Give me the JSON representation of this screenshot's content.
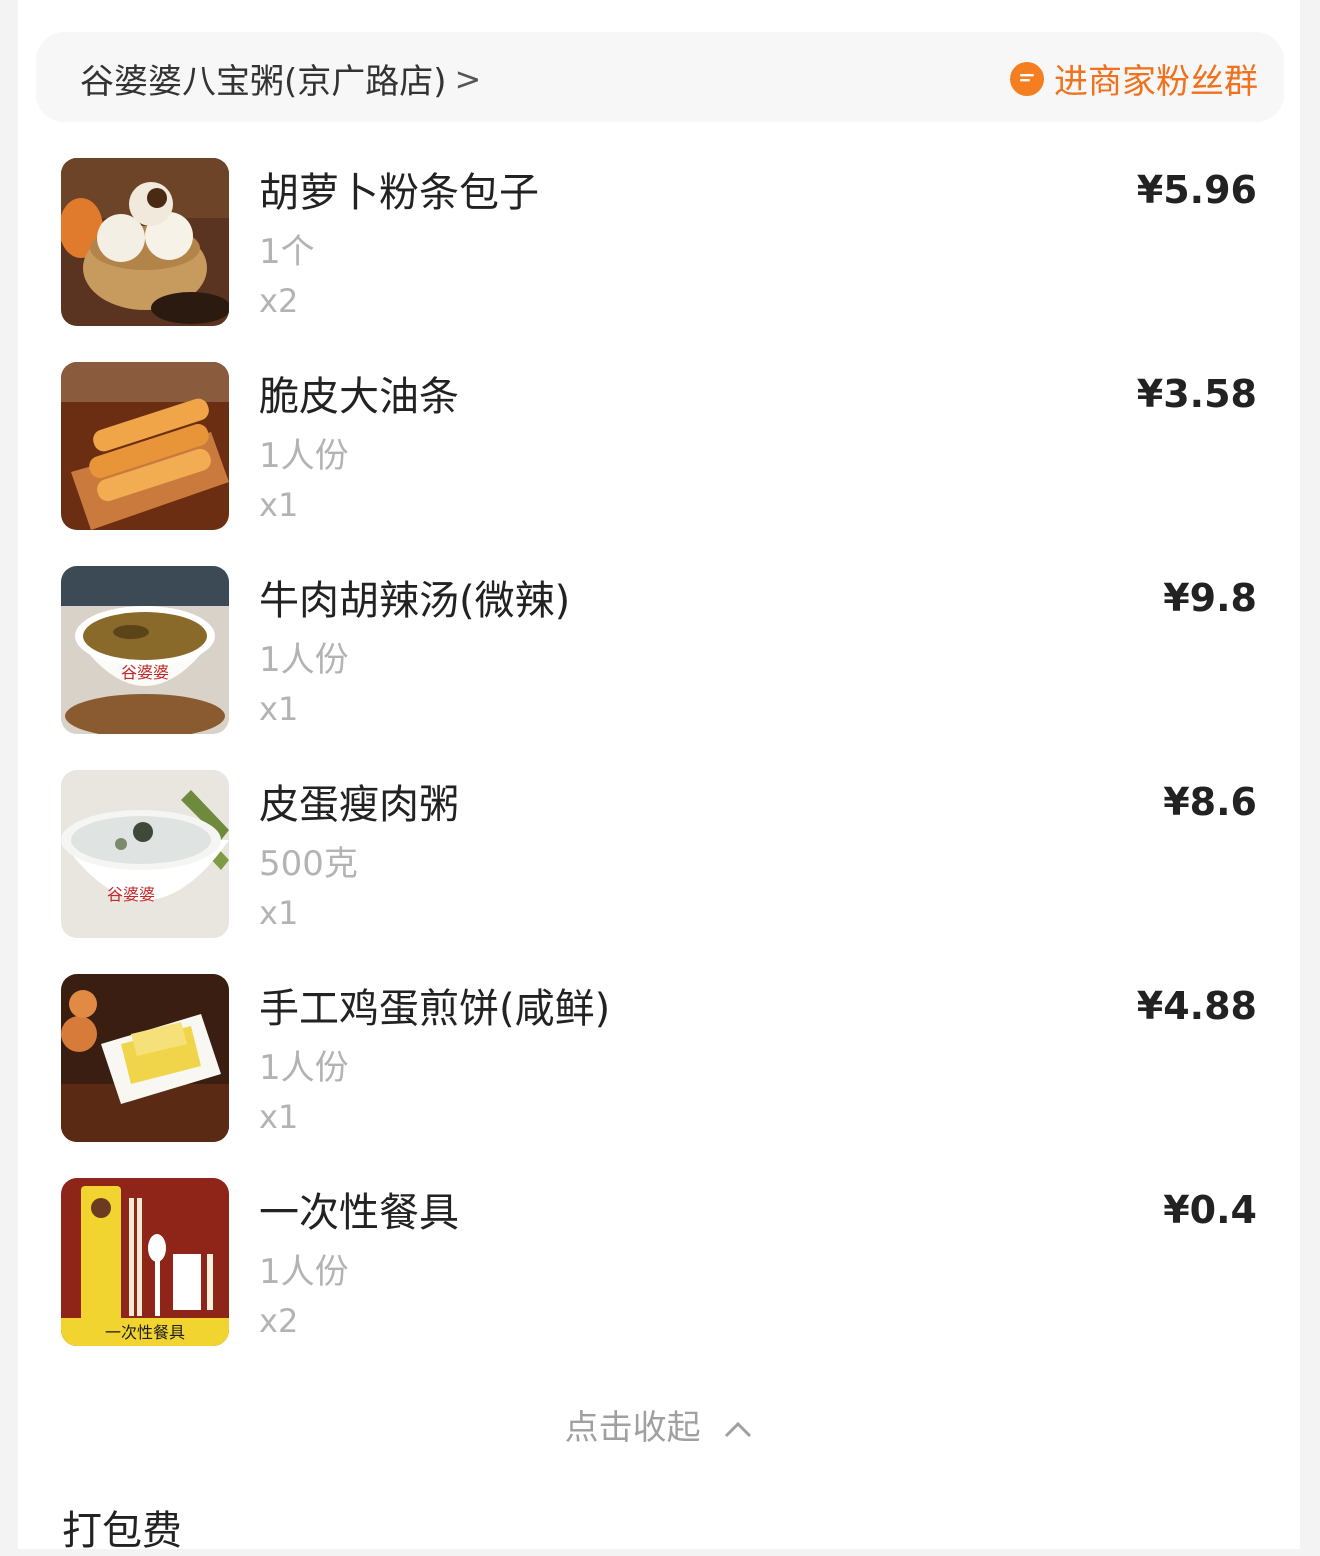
{
  "store": {
    "name": "谷婆婆八宝粥(京广路店)",
    "chevron": ">",
    "fans_label": "进商家粉丝群",
    "fans_icon": "chat-bubble-icon",
    "accent_color": "#f0711e"
  },
  "items": [
    {
      "name": "胡萝卜粉条包子",
      "spec": "1个",
      "qty": "x2",
      "price": "¥5.96",
      "image": "steamed-buns-photo"
    },
    {
      "name": "脆皮大油条",
      "spec": "1人份",
      "qty": "x1",
      "price": "¥3.58",
      "image": "fried-dough-sticks-photo"
    },
    {
      "name": "牛肉胡辣汤(微辣)",
      "spec": "1人份",
      "qty": "x1",
      "price": "¥9.8",
      "image": "spicy-soup-photo"
    },
    {
      "name": "皮蛋瘦肉粥",
      "spec": "500克",
      "qty": "x1",
      "price": "¥8.6",
      "image": "congee-photo"
    },
    {
      "name": "手工鸡蛋煎饼(咸鲜)",
      "spec": "1人份",
      "qty": "x1",
      "price": "¥4.88",
      "image": "egg-pancake-photo"
    },
    {
      "name": "一次性餐具",
      "spec": "1人份",
      "qty": "x2",
      "price": "¥0.4",
      "image": "cutlery-pack-photo"
    }
  ],
  "collapse": {
    "label": "点击收起",
    "icon": "chevron-up-icon"
  },
  "fees": {
    "packaging_label": "打包费"
  }
}
